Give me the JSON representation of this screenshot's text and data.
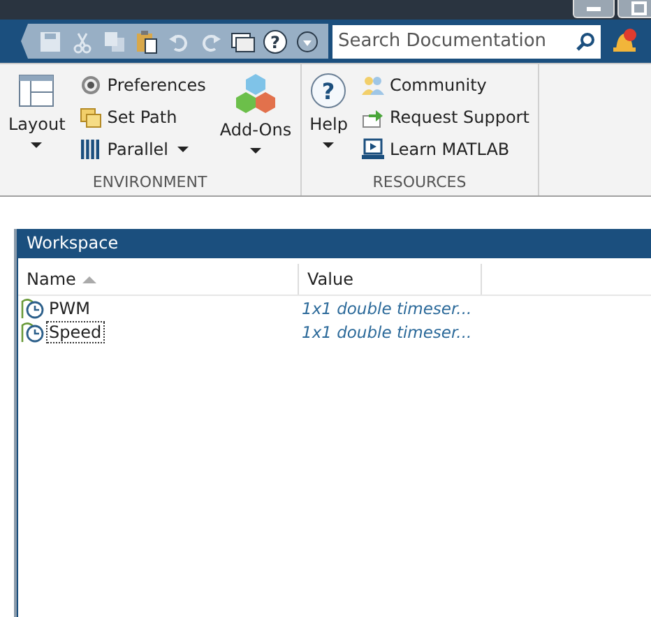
{
  "toolbar": {
    "quick_access": [
      {
        "kind": "save",
        "disabled": true
      },
      {
        "kind": "cut",
        "disabled": true
      },
      {
        "kind": "copy",
        "disabled": true
      },
      {
        "kind": "paste",
        "disabled": false
      },
      {
        "kind": "undo",
        "disabled": true
      },
      {
        "kind": "redo",
        "disabled": true
      },
      {
        "kind": "windows",
        "disabled": false
      },
      {
        "kind": "help",
        "disabled": false,
        "glyph": "?"
      },
      {
        "kind": "more",
        "disabled": false
      }
    ],
    "search": {
      "placeholder": "Search Documentation"
    }
  },
  "ribbon": {
    "groups": [
      {
        "title": "ENVIRONMENT",
        "items": [
          {
            "kind": "large",
            "label": "Layout",
            "dropdown": true
          },
          {
            "kind": "stack",
            "buttons": [
              {
                "label": "Preferences",
                "dropdown": false
              },
              {
                "label": "Set Path",
                "dropdown": false
              },
              {
                "label": "Parallel",
                "dropdown": true
              }
            ]
          },
          {
            "kind": "large",
            "label": "Add-Ons",
            "dropdown": true
          }
        ]
      },
      {
        "title": "RESOURCES",
        "items": [
          {
            "kind": "large",
            "label": "Help",
            "dropdown": true,
            "glyph": "?"
          },
          {
            "kind": "stack",
            "buttons": [
              {
                "label": "Community",
                "dropdown": false
              },
              {
                "label": "Request Support",
                "dropdown": false
              },
              {
                "label": "Learn MATLAB",
                "dropdown": false
              }
            ]
          }
        ]
      }
    ]
  },
  "workspace": {
    "title": "Workspace",
    "columns": [
      {
        "label": "Name",
        "sorted": true
      },
      {
        "label": "Value",
        "sorted": false
      }
    ],
    "rows": [
      {
        "name": "PWM",
        "value": "1x1 double timeser...",
        "focused": false
      },
      {
        "name": "Speed",
        "value": "1x1 double timeser...",
        "focused": true
      }
    ]
  }
}
